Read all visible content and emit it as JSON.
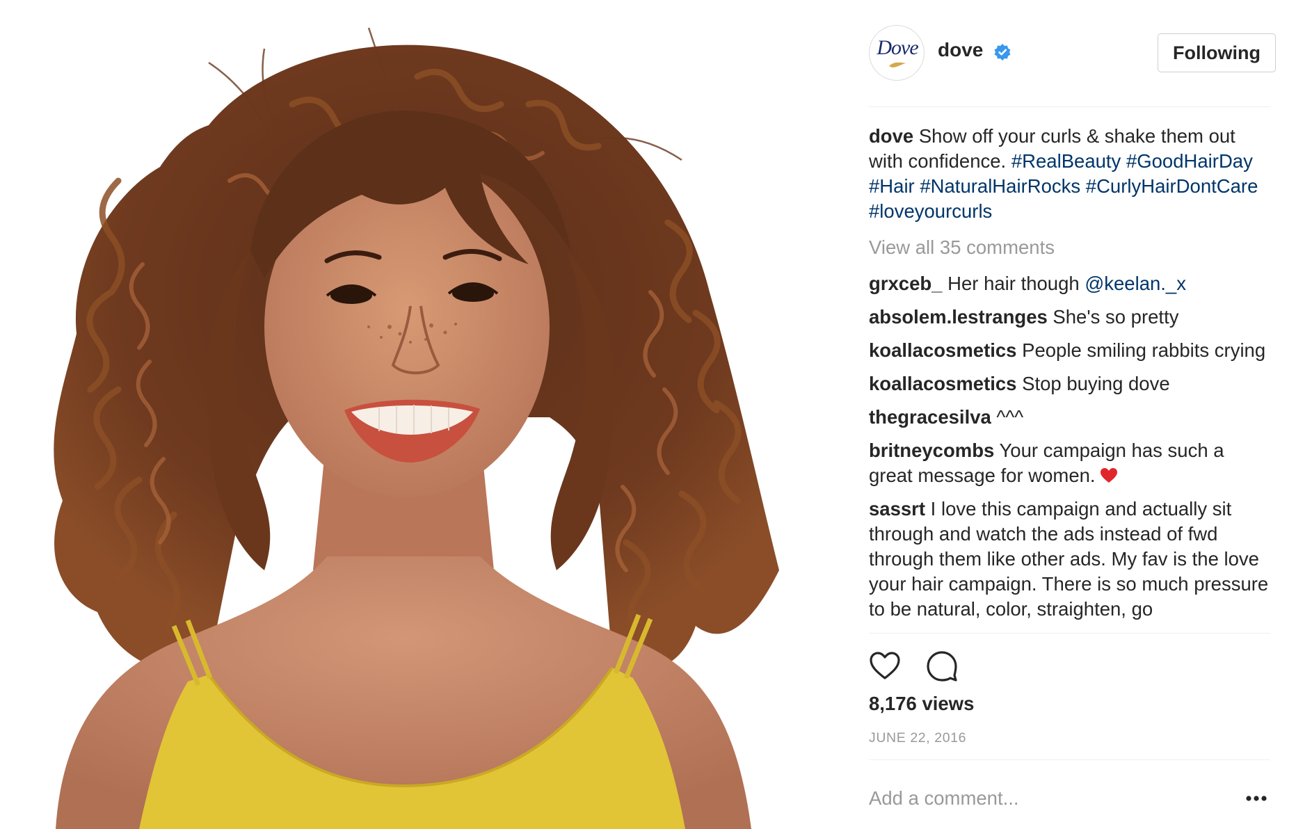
{
  "post": {
    "image_alt": "Smiling woman with voluminous curly brown hair wearing a yellow top",
    "account": {
      "username": "dove",
      "verified": true,
      "avatar_text": "Dove"
    },
    "follow_button": "Following",
    "caption": {
      "username": "dove",
      "text": " Show off your curls & shake them out with confidence. ",
      "hashtags": [
        "#RealBeauty",
        "#GoodHairDay",
        "#Hair",
        "#NaturalHairRocks",
        "#CurlyHairDontCare",
        "#loveyourcurls"
      ]
    },
    "view_all_comments": "View all 35 comments",
    "comments": [
      {
        "username": "grxceb_",
        "text": " Her hair though ",
        "mention": "@keelan._x"
      },
      {
        "username": "absolem.lestranges",
        "text": " She's so pretty"
      },
      {
        "username": "koallacosmetics",
        "text": " People smiling rabbits crying"
      },
      {
        "username": "koallacosmetics",
        "text": " Stop buying dove"
      },
      {
        "username": "thegracesilva",
        "text": " ^^^"
      },
      {
        "username": "britneycombs",
        "text": " Your campaign has such a great message for women.",
        "emoji": "red-heart"
      },
      {
        "username": "sassrt",
        "text": " I love this campaign and actually sit through and watch the ads instead of fwd through them like other ads. My fav is the love your hair campaign. There is so much pressure to be natural, color, straighten, go"
      }
    ],
    "views": "8,176 views",
    "date": "JUNE 22, 2016",
    "add_comment_placeholder": "Add a comment...",
    "icons": {
      "like": "heart-outline-icon",
      "comment": "comment-bubble-icon",
      "verified": "verified-badge-icon",
      "more": "more-options-icon"
    },
    "colors": {
      "hashtag": "#003569",
      "verified": "#3897f0",
      "muted": "#999999",
      "text": "#262626",
      "divider": "#efefef"
    }
  }
}
